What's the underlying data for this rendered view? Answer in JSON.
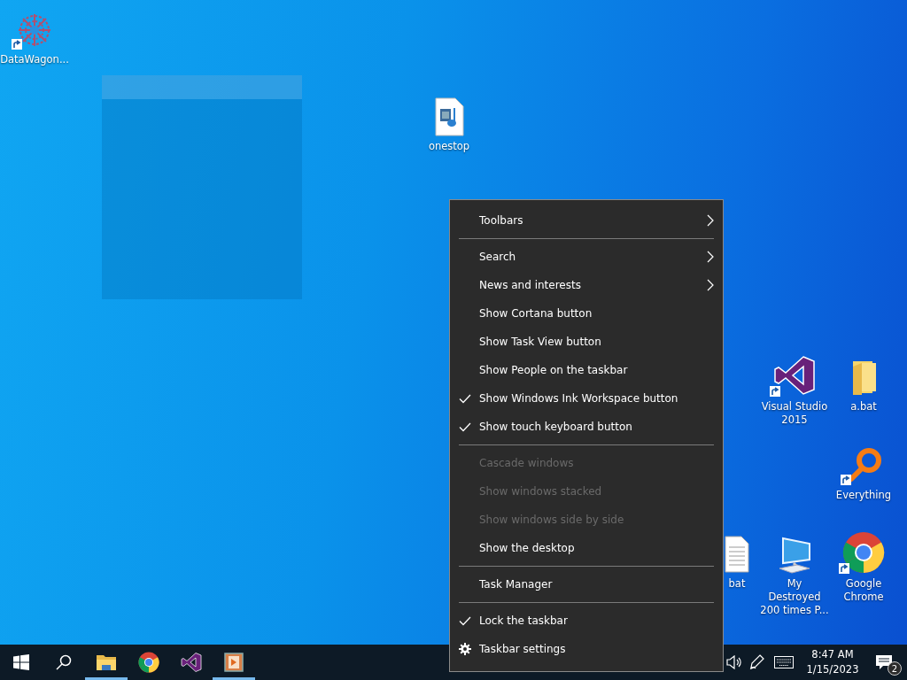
{
  "desktop_icons": [
    {
      "label": "DataWagon...",
      "kind": "gear-cluster",
      "shortcut": true
    },
    {
      "label": "onestop",
      "kind": "media-file",
      "shortcut": false
    },
    {
      "label": "Visual Studio 2015",
      "kind": "visual-studio",
      "shortcut": true
    },
    {
      "label": "a.bat",
      "kind": "folder",
      "shortcut": false
    },
    {
      "label": "Everything",
      "kind": "magnifier",
      "shortcut": true
    },
    {
      "label": "bat",
      "kind": "document",
      "shortcut": false
    },
    {
      "label": "My Destroyed 200 times P...",
      "kind": "computer",
      "shortcut": false
    },
    {
      "label": "Google Chrome",
      "kind": "chrome",
      "shortcut": true
    }
  ],
  "context_menu": {
    "items": [
      {
        "kind": "item",
        "label": "Toolbars",
        "checked": false,
        "disabled": false,
        "submenu": true
      },
      {
        "kind": "separator"
      },
      {
        "kind": "item",
        "label": "Search",
        "checked": false,
        "disabled": false,
        "submenu": true
      },
      {
        "kind": "item",
        "label": "News and interests",
        "checked": false,
        "disabled": false,
        "submenu": true
      },
      {
        "kind": "item",
        "label": "Show Cortana button",
        "checked": false,
        "disabled": false,
        "submenu": false
      },
      {
        "kind": "item",
        "label": "Show Task View button",
        "checked": false,
        "disabled": false,
        "submenu": false
      },
      {
        "kind": "item",
        "label": "Show People on the taskbar",
        "checked": false,
        "disabled": false,
        "submenu": false
      },
      {
        "kind": "item",
        "label": "Show Windows Ink Workspace button",
        "checked": true,
        "disabled": false,
        "submenu": false
      },
      {
        "kind": "item",
        "label": "Show touch keyboard button",
        "checked": true,
        "disabled": false,
        "submenu": false
      },
      {
        "kind": "separator"
      },
      {
        "kind": "item",
        "label": "Cascade windows",
        "checked": false,
        "disabled": true,
        "submenu": false
      },
      {
        "kind": "item",
        "label": "Show windows stacked",
        "checked": false,
        "disabled": true,
        "submenu": false
      },
      {
        "kind": "item",
        "label": "Show windows side by side",
        "checked": false,
        "disabled": true,
        "submenu": false
      },
      {
        "kind": "item",
        "label": "Show the desktop",
        "checked": false,
        "disabled": false,
        "submenu": false
      },
      {
        "kind": "separator"
      },
      {
        "kind": "item",
        "label": "Task Manager",
        "checked": false,
        "disabled": false,
        "submenu": false
      },
      {
        "kind": "separator"
      },
      {
        "kind": "item",
        "label": "Lock the taskbar",
        "checked": true,
        "disabled": false,
        "submenu": false
      },
      {
        "kind": "settings",
        "label": "Taskbar settings",
        "checked": false,
        "disabled": false,
        "submenu": false
      }
    ]
  },
  "taskbar": {
    "apps": [
      {
        "kind": "file-explorer",
        "running": true
      },
      {
        "kind": "chrome",
        "running": false
      },
      {
        "kind": "visual-studio",
        "running": false
      },
      {
        "kind": "media-player",
        "running": true
      }
    ],
    "clock": {
      "time": "8:47 AM",
      "date": "1/15/2023"
    },
    "notifications": {
      "count": "2"
    }
  }
}
